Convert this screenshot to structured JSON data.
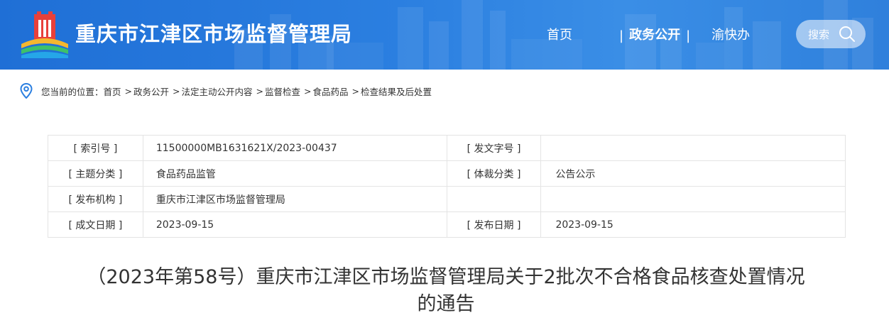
{
  "header": {
    "site_title": "重庆市江津区市场监督管理局",
    "nav": {
      "home": "首页",
      "sep": "|",
      "gov_open": "政务公开",
      "yu_kuai_ban": "渝快办"
    },
    "search_label": "搜索",
    "colors": {
      "bg": "#2b7fe0",
      "text": "#ffffff"
    }
  },
  "breadcrumb": {
    "prefix": "您当前的位置：",
    "items": [
      "首页",
      "政务公开",
      "法定主动公开内容",
      "监督检查",
      "食品药品",
      "检查结果及后处置"
    ],
    "sep": ">"
  },
  "info_table": {
    "rows": [
      {
        "label1": "[ 索引号 ]",
        "value1": "11500000MB1631621X/2023-00437",
        "label2": "[ 发文字号 ]",
        "value2": ""
      },
      {
        "label1": "[ 主题分类 ]",
        "value1": "食品药品监管",
        "label2": "[ 体裁分类 ]",
        "value2": "公告公示"
      },
      {
        "label1": "[ 发布机构 ]",
        "value1": "重庆市江津区市场监督管理局",
        "label2": "",
        "value2": ""
      },
      {
        "label1": "[ 成文日期 ]",
        "value1": "2023-09-15",
        "label2": "[ 发布日期 ]",
        "value2": "2023-09-15"
      }
    ]
  },
  "article": {
    "title_line1": "（2023年第58号）重庆市江津区市场监督管理局关于2批次不合格食品核查处置情况",
    "title_line2": "的通告"
  }
}
